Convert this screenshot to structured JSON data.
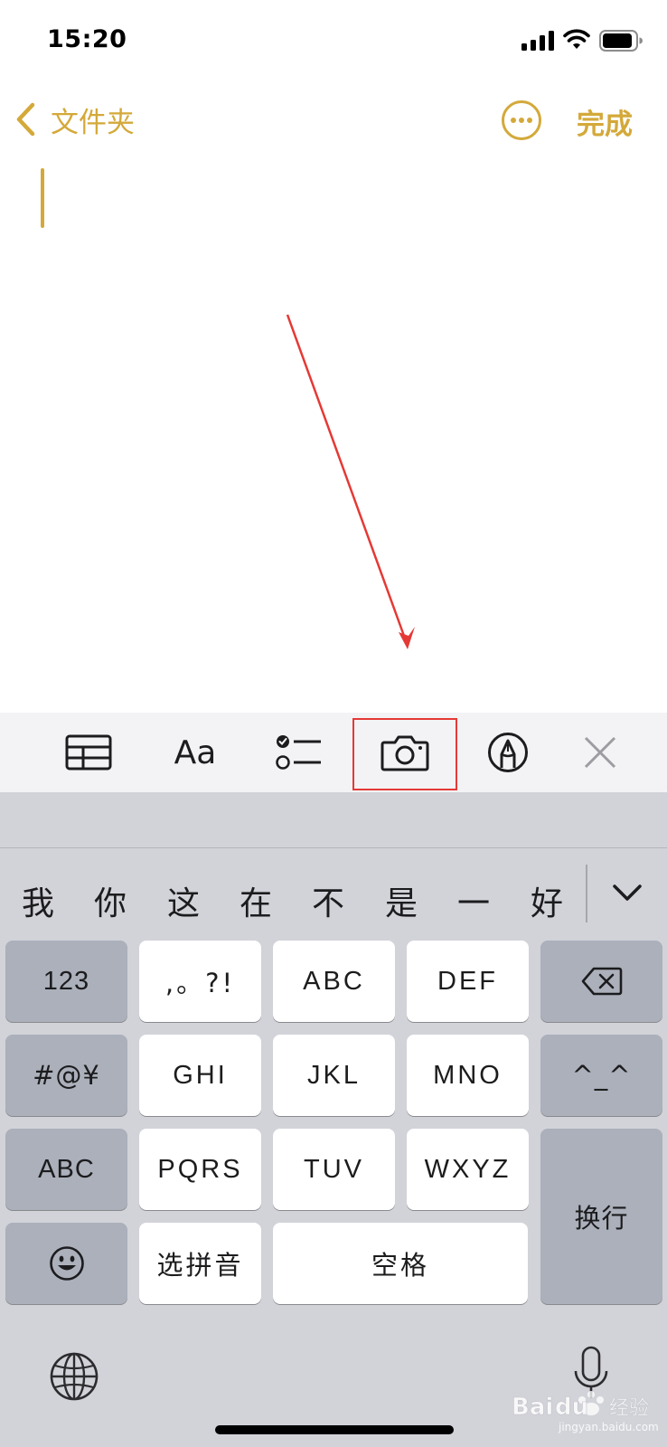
{
  "status_bar": {
    "time": "15:20"
  },
  "nav": {
    "back_label": "文件夹",
    "done_label": "完成"
  },
  "toolbar": {
    "items": [
      {
        "name": "table",
        "icon": "table-icon"
      },
      {
        "name": "format",
        "label": "Aa",
        "icon": "text-format-icon"
      },
      {
        "name": "checklist",
        "icon": "checklist-icon"
      },
      {
        "name": "camera",
        "icon": "camera-icon",
        "highlighted": true
      },
      {
        "name": "markup",
        "icon": "pen-marker-icon"
      },
      {
        "name": "close",
        "icon": "close-icon"
      }
    ]
  },
  "keyboard": {
    "candidates": [
      "我",
      "你",
      "这",
      "在",
      "不",
      "是",
      "一",
      "好"
    ],
    "keys": {
      "numbers": "123",
      "punct": ",。?!",
      "abc": "ABC",
      "def": "DEF",
      "symbols": "#@¥",
      "ghi": "GHI",
      "jkl": "JKL",
      "mno": "MNO",
      "emoticon": "^_^",
      "abc_switch": "ABC",
      "pqrs": "PQRS",
      "tuv": "TUV",
      "wxyz": "WXYZ",
      "return": "换行",
      "select_pinyin": "选拼音",
      "space": "空格"
    }
  },
  "colors": {
    "accent": "#d4a93a",
    "annotation": "#e53935"
  },
  "watermark": {
    "text": "Baidu 经验",
    "subtext": "jingyan.baidu.com"
  }
}
